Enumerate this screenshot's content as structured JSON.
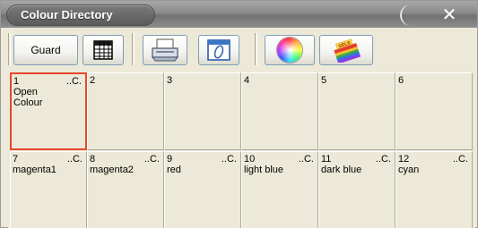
{
  "window": {
    "title": "Colour Directory",
    "close_glyph": "✕"
  },
  "toolbar": {
    "guard_label": "Guard",
    "buttons": [
      {
        "icon": "spreadsheet-icon"
      },
      {
        "icon": "printer-icon"
      },
      {
        "icon": "edit-icon"
      },
      {
        "icon": "colour-wheel-icon"
      },
      {
        "icon": "gels-icon",
        "icon_text": "GELS"
      }
    ]
  },
  "grid": {
    "cells": [
      {
        "num": "1",
        "code": "..C.",
        "name": "Open\nColour",
        "selected": true
      },
      {
        "num": "2",
        "code": "",
        "name": ""
      },
      {
        "num": "3",
        "code": "",
        "name": ""
      },
      {
        "num": "4",
        "code": "",
        "name": ""
      },
      {
        "num": "5",
        "code": "",
        "name": ""
      },
      {
        "num": "6",
        "code": "",
        "name": ""
      },
      {
        "num": "7",
        "code": "..C.",
        "name": "magenta1"
      },
      {
        "num": "8",
        "code": "..C.",
        "name": "magenta2"
      },
      {
        "num": "9",
        "code": "..C.",
        "name": "red"
      },
      {
        "num": "10",
        "code": "..C.",
        "name": "light blue"
      },
      {
        "num": "11",
        "code": "..C.",
        "name": "dark blue"
      },
      {
        "num": "12",
        "code": "..C.",
        "name": "cyan"
      }
    ]
  },
  "colors": {
    "selection": "#e8462c",
    "title_bar": "#7a7a7a"
  }
}
